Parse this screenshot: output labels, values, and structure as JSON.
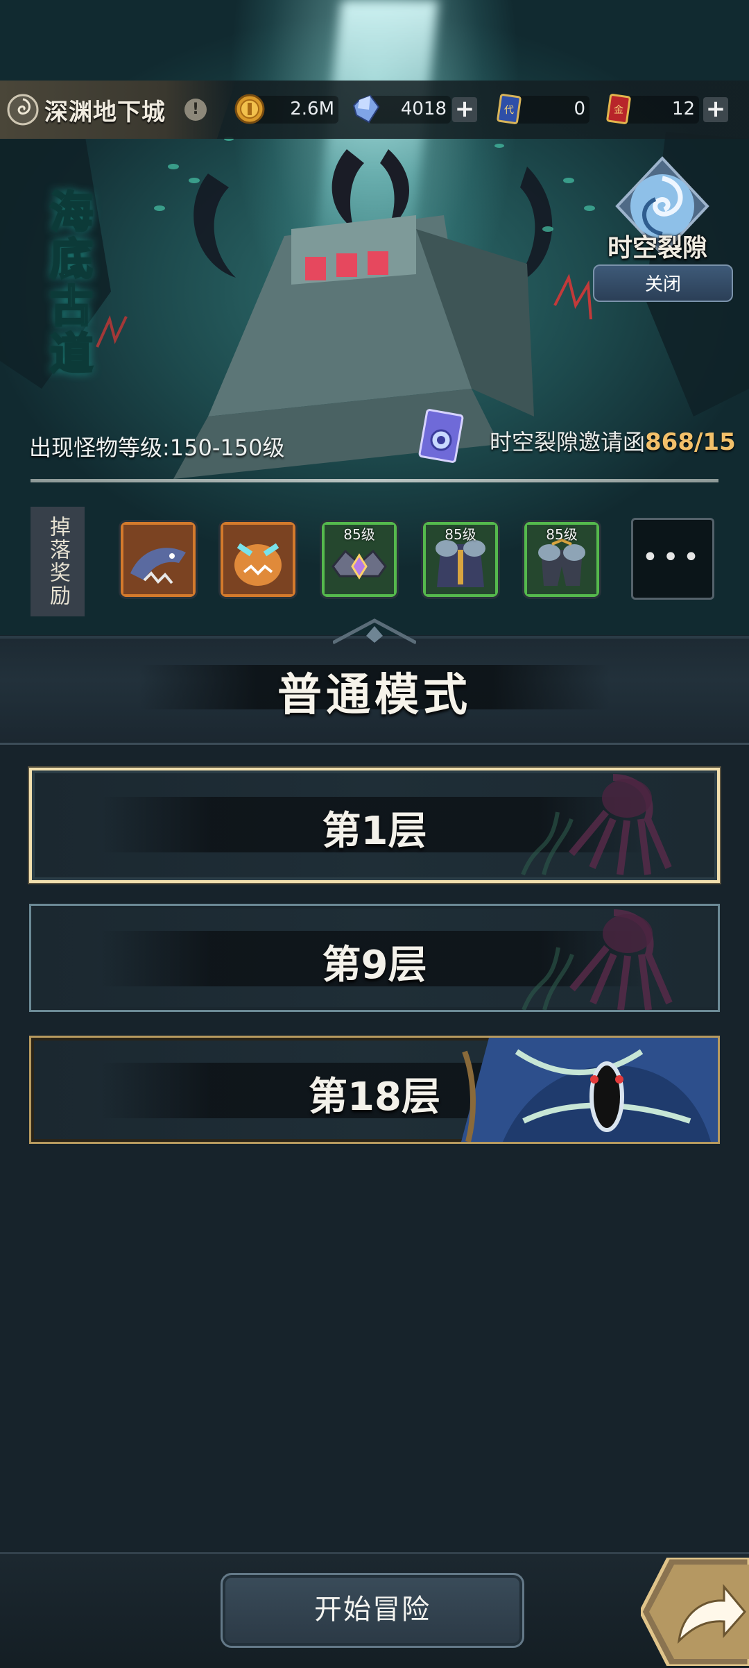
{
  "header": {
    "dungeon_name": "深渊地下城",
    "info_mark": "!"
  },
  "resources": [
    {
      "icon": "gold-coin-icon",
      "value": "2.6M"
    },
    {
      "icon": "crystal-icon",
      "value": "4018",
      "has_plus": true
    },
    {
      "icon": "voucher-card-icon",
      "value": "0"
    },
    {
      "icon": "gold-card-icon",
      "value": "12",
      "has_plus": true
    }
  ],
  "rift": {
    "label": "时空裂隙",
    "close_label": "关闭"
  },
  "dungeon_art_title": "海底古道",
  "monster_level": "出现怪物等级:150-150级",
  "invite": {
    "label": "时空裂隙邀请函",
    "count": "868/15"
  },
  "drops": {
    "label": "掉落奖励",
    "items": [
      {
        "icon": "shark-monster-icon",
        "rarity": "orange"
      },
      {
        "icon": "orange-beast-icon",
        "rarity": "orange"
      },
      {
        "icon": "crown-gem-icon",
        "rarity": "green",
        "level": "85级"
      },
      {
        "icon": "armor-robe-icon",
        "rarity": "green",
        "level": "85级"
      },
      {
        "icon": "armor-pants-icon",
        "rarity": "green",
        "level": "85级"
      }
    ],
    "more": "•••"
  },
  "mode": {
    "title": "普通模式"
  },
  "floors": [
    {
      "label": "第1层",
      "selected": true
    },
    {
      "label": "第9层"
    },
    {
      "label": "第18层",
      "boss": true
    }
  ],
  "bottom": {
    "start_label": "开始冒险",
    "share_icon": "share-arrow-icon"
  },
  "colors": {
    "invite_count": "#f2c06a",
    "selected_border": "#f1dfae",
    "rarity_orange": "#d47a2c",
    "rarity_green": "#55b94d"
  }
}
